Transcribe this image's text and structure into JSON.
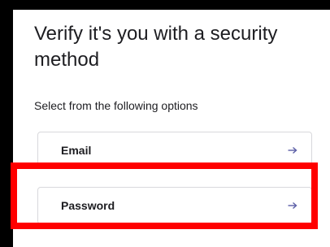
{
  "page": {
    "title": "Verify it's you with a security method",
    "subtitle": "Select from the following options"
  },
  "options": [
    {
      "label": "Email",
      "icon": "arrow-right-icon"
    },
    {
      "label": "Password",
      "icon": "arrow-right-icon"
    }
  ],
  "colors": {
    "background": "#000000",
    "card": "#ffffff",
    "text": "#1d1d21",
    "arrow": "#5b5ea6",
    "highlight": "#ff0000",
    "option_border": "#d8d8dc"
  }
}
